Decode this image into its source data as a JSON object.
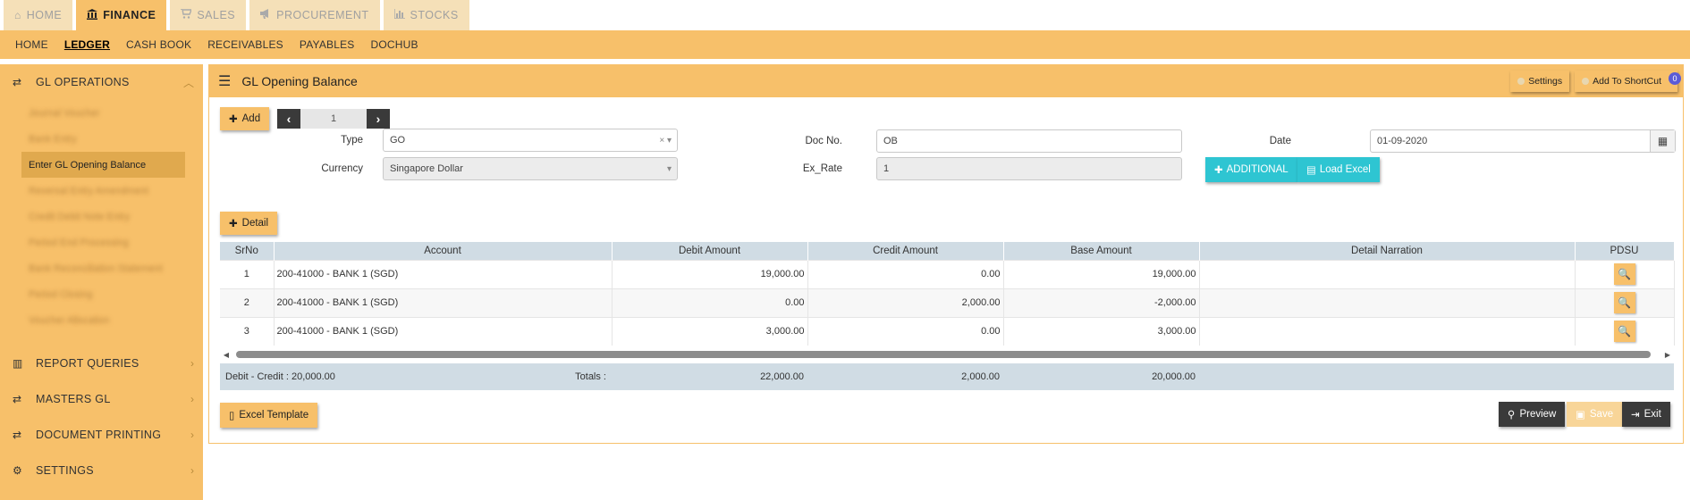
{
  "top_tabs": [
    {
      "label": "HOME",
      "icon": "home-icon",
      "glyph": "⌂"
    },
    {
      "label": "FINANCE",
      "icon": "bank-icon",
      "glyph": "🏛"
    },
    {
      "label": "SALES",
      "icon": "cart-icon",
      "glyph": "🛒"
    },
    {
      "label": "PROCUREMENT",
      "icon": "megaphone-icon",
      "glyph": "📢"
    },
    {
      "label": "STOCKS",
      "icon": "bar-chart-icon",
      "glyph": "▥"
    }
  ],
  "sub_nav": [
    "HOME",
    "LEDGER",
    "CASH BOOK",
    "RECEIVABLES",
    "PAYABLES",
    "DOCHUB"
  ],
  "sidebar": {
    "gl_operations": "GL OPERATIONS",
    "sub_items": [
      "Enter GL Opening Balance"
    ],
    "report_queries": "REPORT QUERIES",
    "masters_gl": "MASTERS GL",
    "document_printing": "DOCUMENT PRINTING",
    "settings": "SETTINGS"
  },
  "panel": {
    "title": "GL Opening Balance",
    "settings_label": "Settings",
    "shortcut_label": "Add To ShortCut",
    "shortcut_count": "0"
  },
  "toolbar": {
    "add_label": "Add",
    "page_number": "1",
    "detail_label": "Detail"
  },
  "form": {
    "type_label": "Type",
    "type_value": "GO",
    "currency_label": "Currency",
    "currency_value": "Singapore Dollar",
    "docno_label": "Doc No.",
    "docno_value": "OB",
    "exrate_label": "Ex_Rate",
    "exrate_value": "1",
    "date_label": "Date",
    "date_value": "01-09-2020",
    "additional_label": "ADDITIONAL",
    "load_excel_label": "Load Excel"
  },
  "grid": {
    "columns": [
      "SrNo",
      "Account",
      "Debit Amount",
      "Credit Amount",
      "Base Amount",
      "Detail Narration",
      "PDSU"
    ],
    "rows": [
      {
        "srno": "1",
        "account": "200-41000 - BANK 1 (SGD)",
        "debit": "19,000.00",
        "credit": "0.00",
        "base": "19,000.00",
        "narration": ""
      },
      {
        "srno": "2",
        "account": "200-41000 - BANK 1 (SGD)",
        "debit": "0.00",
        "credit": "2,000.00",
        "base": "-2,000.00",
        "narration": ""
      },
      {
        "srno": "3",
        "account": "200-41000 - BANK 1 (SGD)",
        "debit": "3,000.00",
        "credit": "0.00",
        "base": "3,000.00",
        "narration": ""
      }
    ]
  },
  "totals": {
    "diff_label": "Debit - Credit : 20,000.00",
    "totals_label": "Totals :",
    "debit": "22,000.00",
    "credit": "2,000.00",
    "base": "20,000.00"
  },
  "footer": {
    "excel_template_label": "Excel Template",
    "preview_label": "Preview",
    "save_label": "Save",
    "exit_label": "Exit"
  },
  "colors": {
    "accent": "#f7c06a",
    "teal": "#2ec5d2",
    "dark": "#3a3a3a",
    "grid_header": "#d0dce4"
  }
}
